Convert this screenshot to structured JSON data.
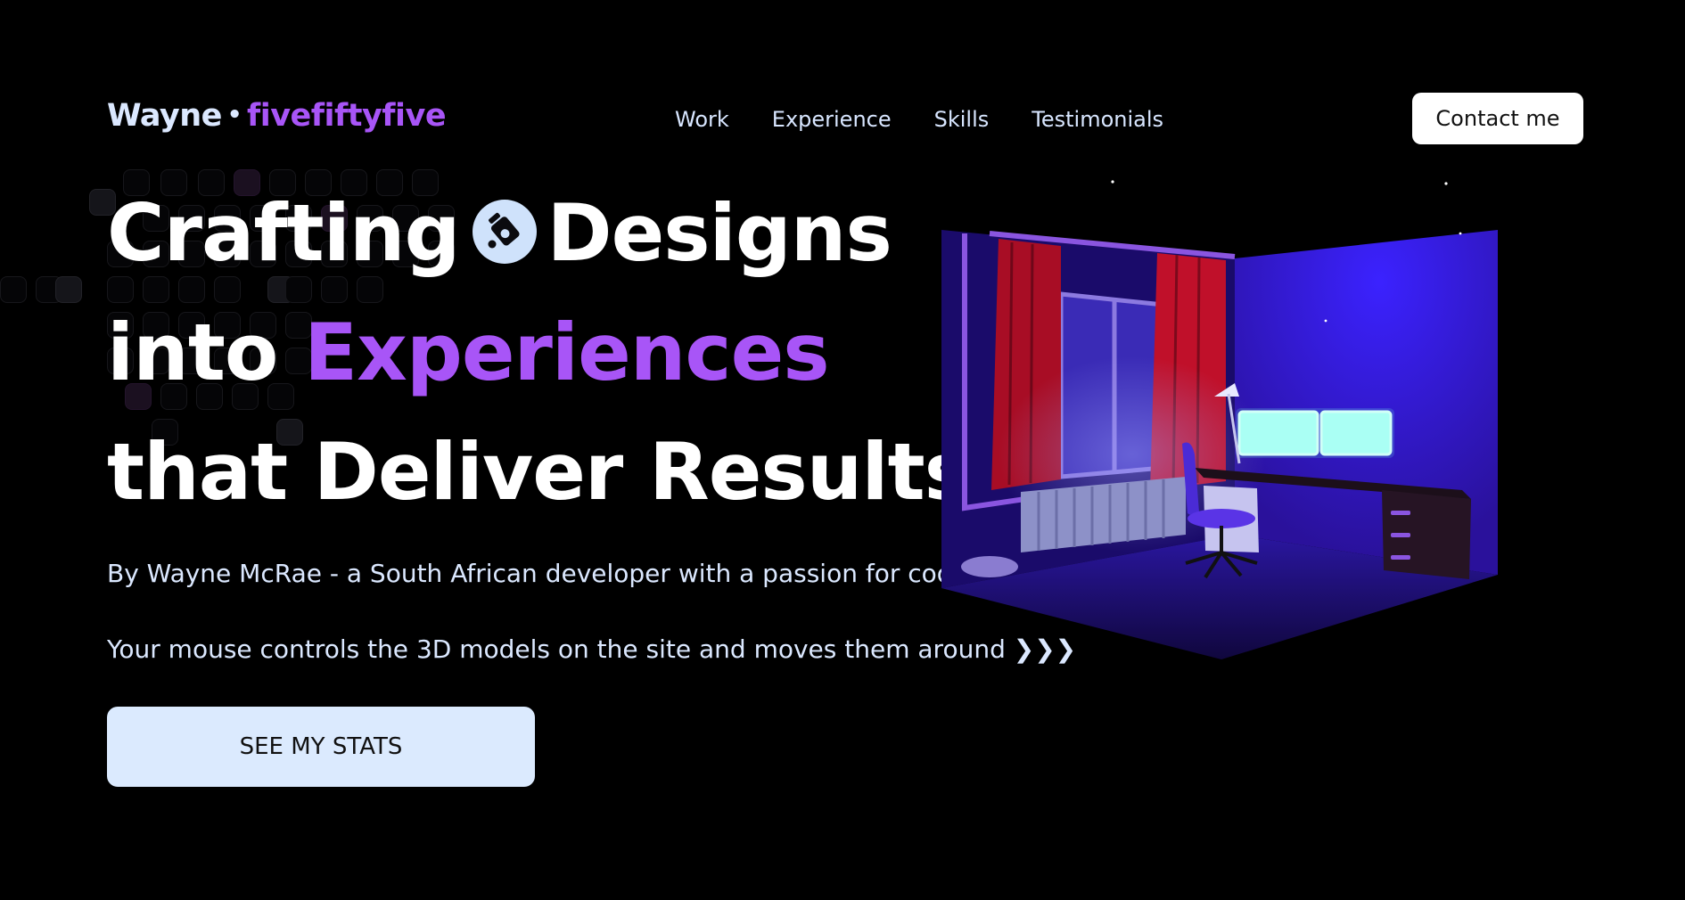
{
  "nav": {
    "logo_name": "Wayne",
    "logo_separator": "•",
    "logo_brand": "fivefiftyfive",
    "links": [
      "Work",
      "Experience",
      "Skills",
      "Testimonials"
    ],
    "contact_label": "Contact me"
  },
  "hero": {
    "line1_part1": "Crafting",
    "line1_part2": "Designs",
    "line2_part1": "into",
    "line2_accent": "Experiences",
    "line3": "that Deliver Results",
    "subtitle": "By Wayne McRae - a South African developer with a passion for code.",
    "mouse_hint": "Your mouse controls the 3D models on the site and moves them around ❯❯❯",
    "cta_label": "SEE MY STATS"
  },
  "colors": {
    "background": "#000000",
    "accent_purple": "#a855f7",
    "light_blue": "#dbeafe",
    "room_wall": "#2a14a8",
    "curtain_red": "#c0102a"
  },
  "icons": [
    "pen-tool-icon",
    "chevrons-right-icon"
  ]
}
